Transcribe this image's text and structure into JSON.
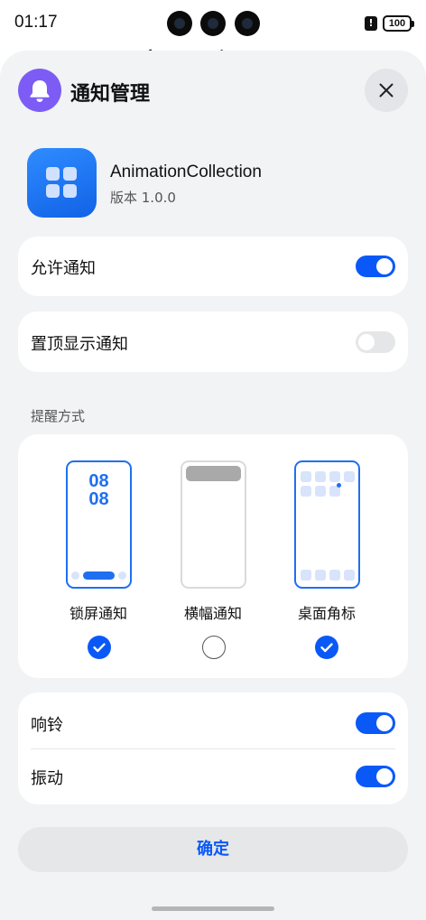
{
  "status_bar": {
    "time": "01:17",
    "battery": "100"
  },
  "background_page": {
    "title": "这是主界面"
  },
  "sheet": {
    "title": "通知管理",
    "app": {
      "name": "AnimationCollection",
      "version": "版本 1.0.0"
    },
    "allow_notifications": {
      "label": "允许通知",
      "enabled": true
    },
    "pinned_notifications": {
      "label": "置顶显示通知",
      "enabled": false
    },
    "reminder_section": {
      "title": "提醒方式",
      "styles": [
        {
          "label": "锁屏通知",
          "checked": true,
          "preview_time_line1": "08",
          "preview_time_line2": "08"
        },
        {
          "label": "横幅通知",
          "checked": false
        },
        {
          "label": "桌面角标",
          "checked": true
        }
      ]
    },
    "ring": {
      "label": "响铃",
      "enabled": true
    },
    "vibrate": {
      "label": "振动",
      "enabled": true
    },
    "confirm_label": "确定"
  },
  "colors": {
    "accent": "#0a59f7",
    "header_icon": "#7d5cf5",
    "sheet_bg": "#f1f3f5"
  }
}
